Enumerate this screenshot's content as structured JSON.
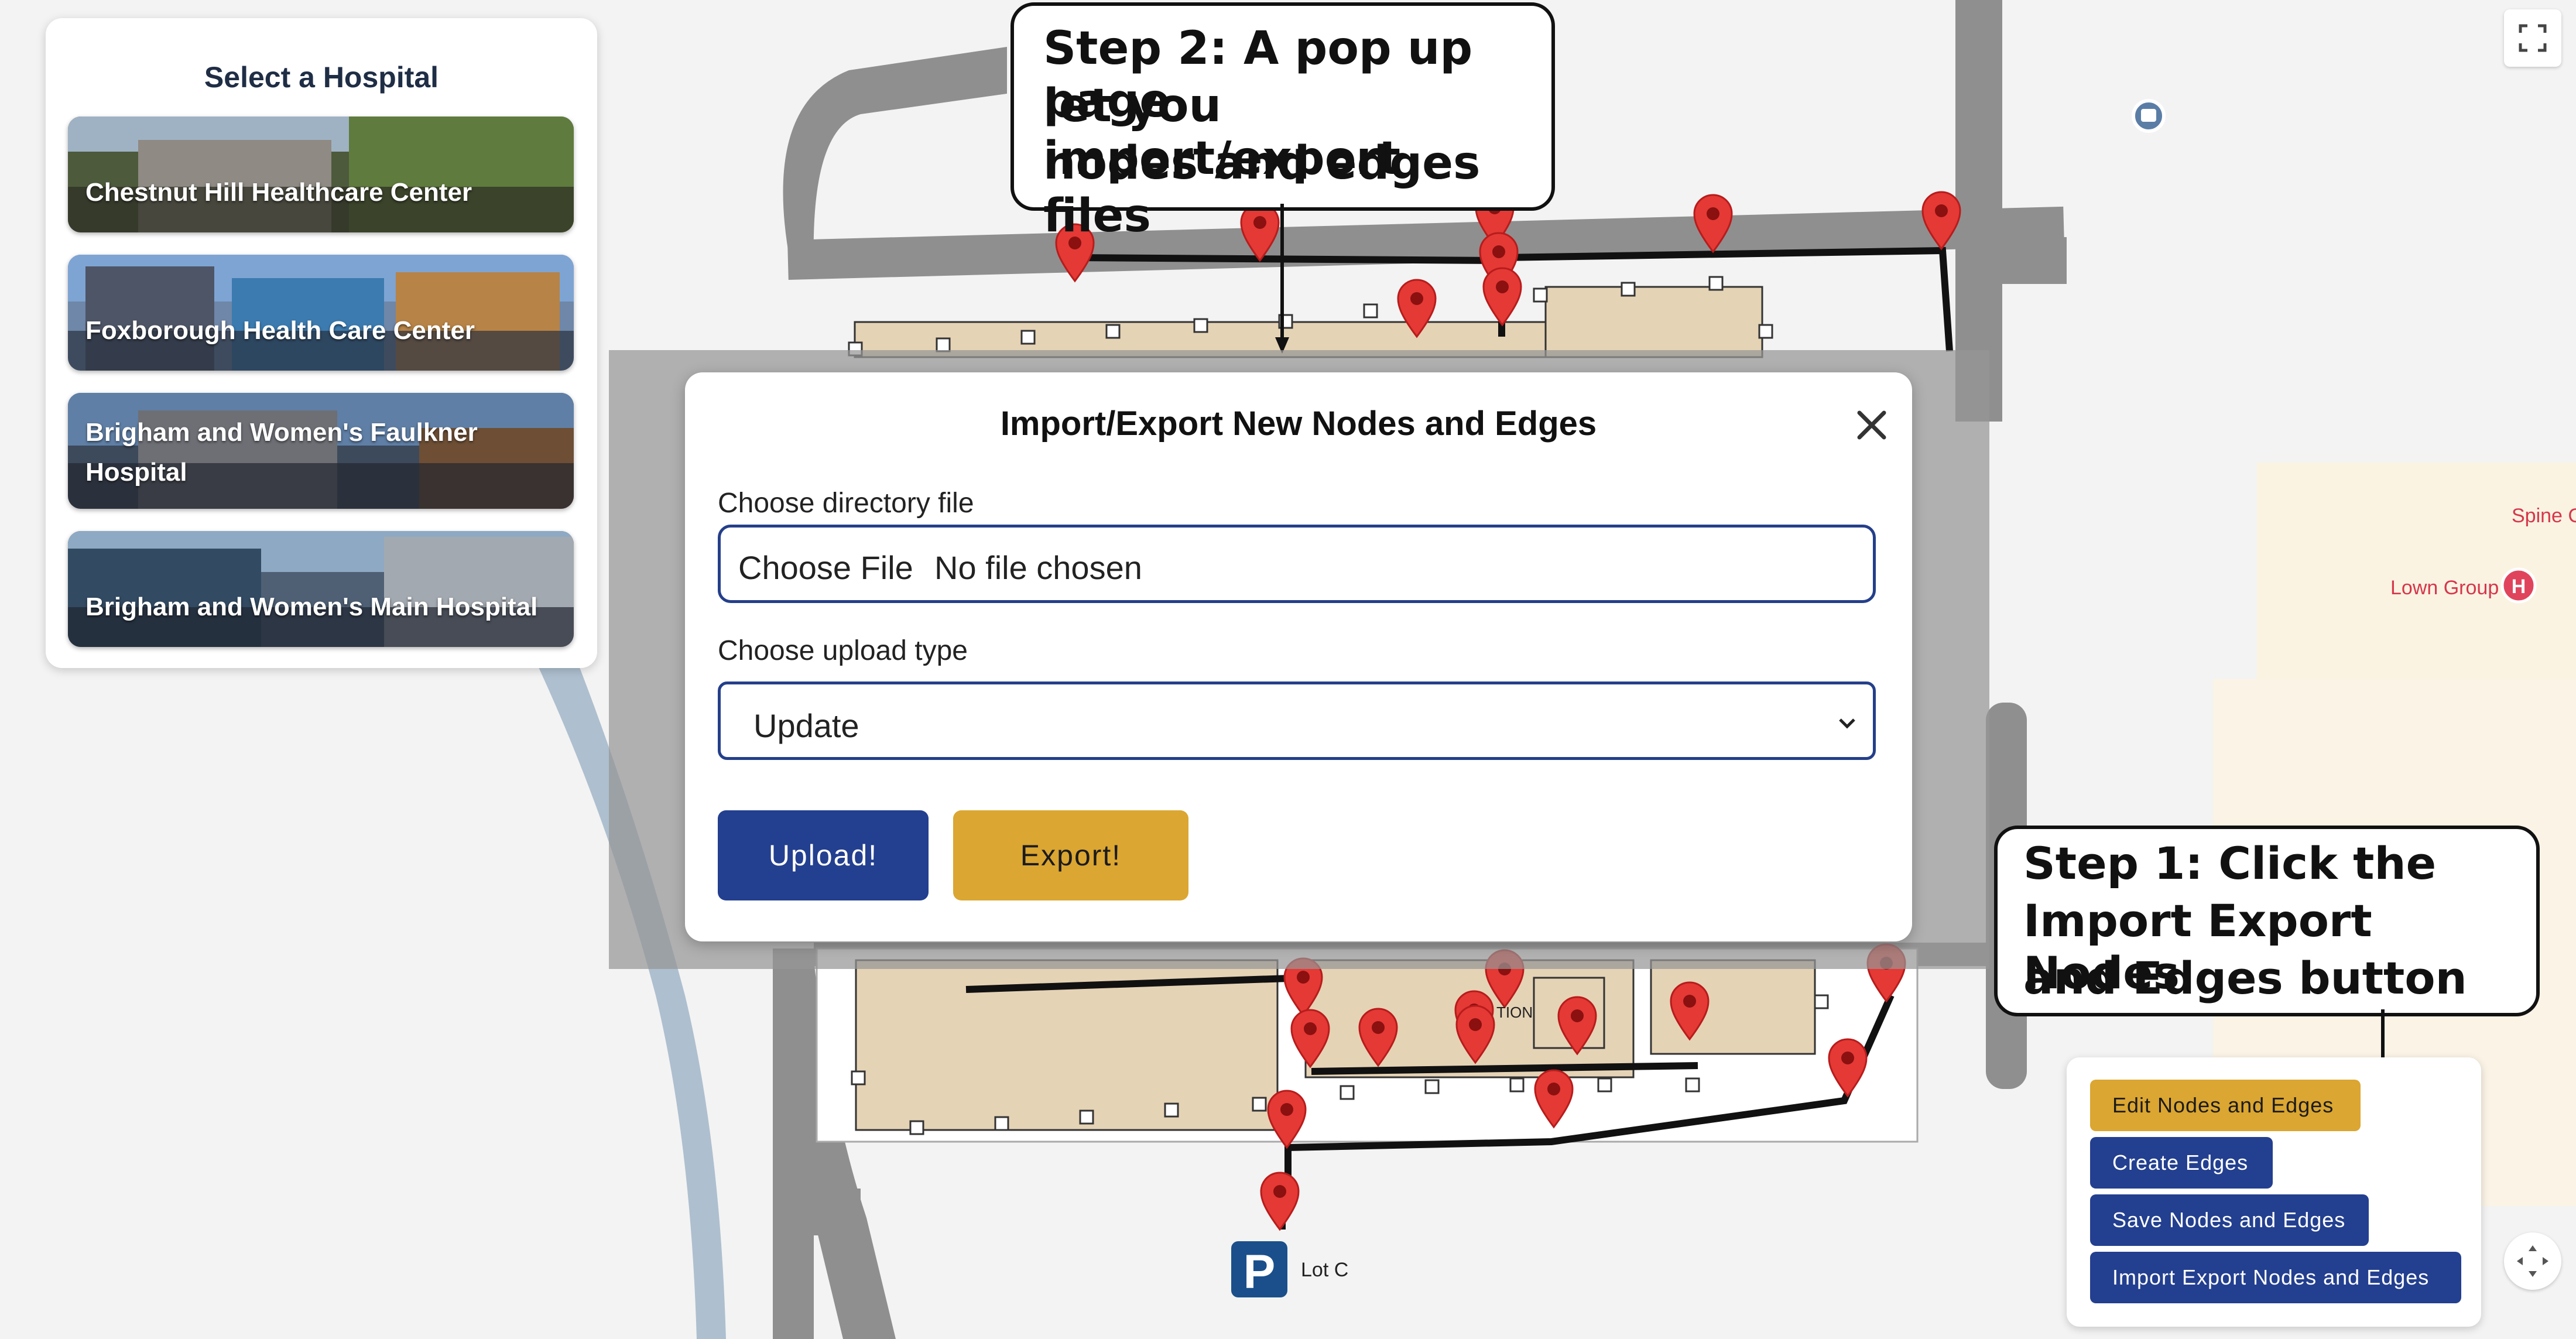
{
  "sidebar": {
    "title": "Select a Hospital",
    "hospitals": [
      {
        "name": "Chestnut Hill Healthcare Center"
      },
      {
        "name": "Foxborough Health Care Center"
      },
      {
        "name": "Brigham and Women's Faulkner Hospital"
      },
      {
        "name": "Brigham and Women's Main Hospital"
      }
    ]
  },
  "map": {
    "labels": {
      "spine": "Spine C",
      "lown": "Lown Group",
      "lot": "Lot C",
      "building_text": "TION"
    },
    "icons": {
      "hospital_marker": "H",
      "parking": "P"
    },
    "colors": {
      "path": "#111111",
      "node_marker": "#e53935",
      "building_fill": "#e5d3b5"
    }
  },
  "callouts": {
    "step2_lines": [
      "Step 2: A pop up page",
      "let you import/export",
      "nodes and edges files"
    ],
    "step1_lines": [
      "Step 1: Click the",
      "Import Export Nodes",
      "and Edges button"
    ]
  },
  "modal": {
    "title": "Import/Export New Nodes and Edges",
    "close_icon": "close-icon",
    "directory_label": "Choose directory file",
    "file_button_text": "Choose File",
    "file_status": "No file chosen",
    "upload_type_label": "Choose upload type",
    "upload_type_value": "Update",
    "upload_button": "Upload!",
    "export_button": "Export!"
  },
  "actions": {
    "edit": "Edit Nodes and Edges",
    "create": "Create Edges",
    "save": "Save Nodes and Edges",
    "import_export": "Import Export Nodes and Edges"
  },
  "colors": {
    "primary_blue": "#233f8f",
    "gold": "#dba631",
    "modal_border": "#243f8a"
  }
}
